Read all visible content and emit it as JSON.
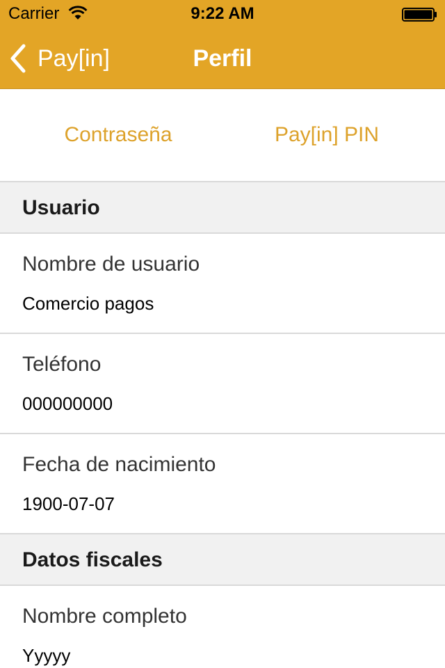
{
  "status_bar": {
    "carrier": "Carrier",
    "time": "9:22 AM"
  },
  "nav": {
    "back_label": "Pay[in]",
    "title": "Perfil"
  },
  "actions": {
    "password_label": "Contraseña",
    "pin_label": "Pay[in] PIN"
  },
  "sections": {
    "user": {
      "title": "Usuario",
      "fields": [
        {
          "label": "Nombre de usuario",
          "value": "Comercio pagos"
        },
        {
          "label": "Teléfono",
          "value": "000000000"
        },
        {
          "label": "Fecha de nacimiento",
          "value": "1900-07-07"
        }
      ]
    },
    "fiscal": {
      "title": "Datos fiscales",
      "fields": [
        {
          "label": "Nombre completo",
          "value": "Yyyyy"
        }
      ]
    }
  },
  "colors": {
    "nav_background": "#E3A526",
    "accent": "#DDA22B",
    "section_background": "#F1F1F1",
    "separator": "#D9D9D9"
  },
  "icons": {
    "wifi": "wifi-icon",
    "battery": "battery-icon",
    "back": "chevron-left-icon"
  },
  "battery_level": 1.0
}
